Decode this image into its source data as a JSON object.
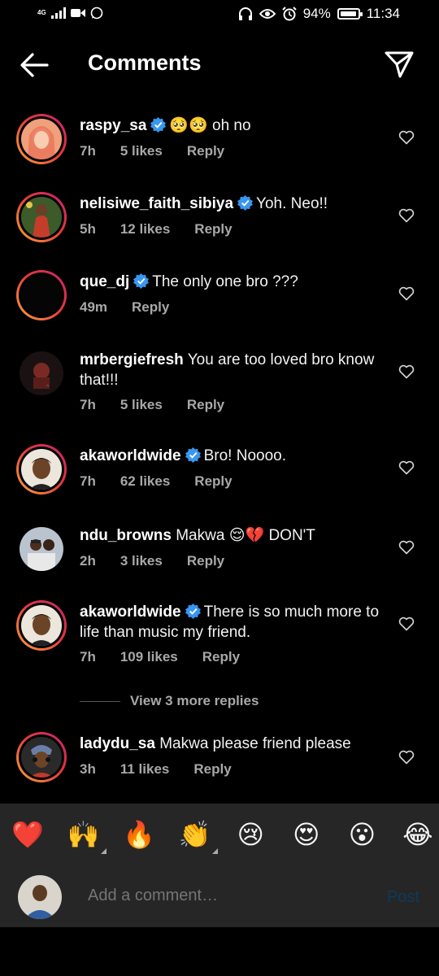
{
  "status": {
    "network": "4G",
    "battery": "94%",
    "battery_level": 0.94,
    "time": "11:34"
  },
  "header": {
    "title": "Comments"
  },
  "comments": [
    {
      "user": "raspy_sa",
      "verified": true,
      "text": "🥺🥺 oh no",
      "time": "7h",
      "likes": "5 likes",
      "reply": "Reply"
    },
    {
      "user": "nelisiwe_faith_sibiya",
      "verified": true,
      "text": "Yoh. Neo!!",
      "time": "5h",
      "likes": "12 likes",
      "reply": "Reply"
    },
    {
      "user": "que_dj",
      "verified": true,
      "text": "The only one bro ???",
      "time": "49m",
      "likes": "",
      "reply": "Reply"
    },
    {
      "user": "mrbergiefresh",
      "verified": false,
      "text": "You are too loved bro know that!!!",
      "time": "7h",
      "likes": "5 likes",
      "reply": "Reply"
    },
    {
      "user": "akaworldwide",
      "verified": true,
      "text": "Bro! Noooo.",
      "time": "7h",
      "likes": "62 likes",
      "reply": "Reply"
    },
    {
      "user": "ndu_browns",
      "verified": false,
      "text": "Makwa 😌💔 DON'T",
      "time": "2h",
      "likes": "3 likes",
      "reply": "Reply"
    },
    {
      "user": "akaworldwide",
      "verified": true,
      "text": "There is so much more to life than music my friend.",
      "time": "7h",
      "likes": "109 likes",
      "reply": "Reply"
    },
    {
      "user": "ladydu_sa",
      "verified": false,
      "text": "Makwa please friend please",
      "time": "3h",
      "likes": "11 likes",
      "reply": "Reply"
    }
  ],
  "view_more": "View 3 more replies",
  "emoji_bar": [
    "❤️",
    "🙌",
    "🔥",
    "👏",
    "😢",
    "😍",
    "😮",
    "😂"
  ],
  "compose": {
    "placeholder": "Add a comment…",
    "post_label": "Post"
  },
  "colors": {
    "background": "#000000",
    "meta_text": "#a8a8a8",
    "verified_blue": "#3897f0",
    "post_disabled": "#0e3a5c",
    "composer_bg": "#262626"
  }
}
